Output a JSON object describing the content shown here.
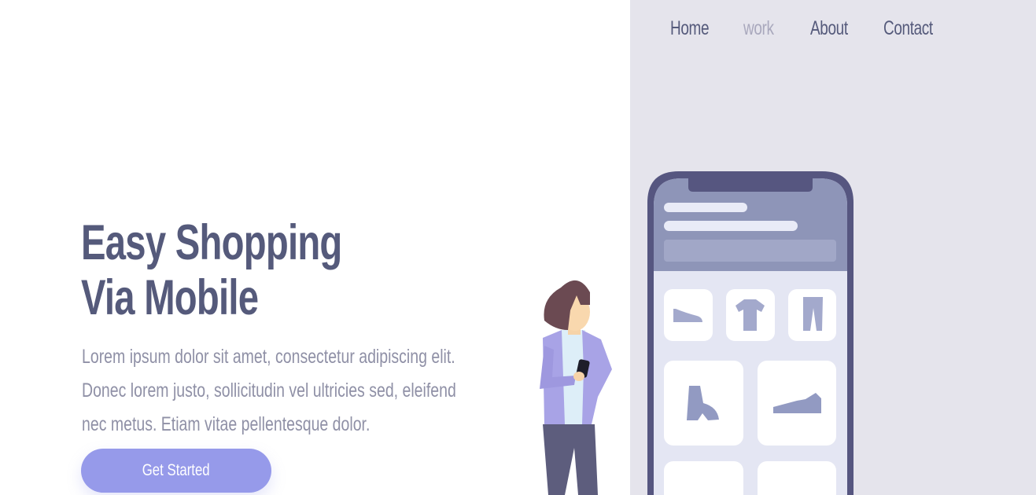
{
  "nav": {
    "items": [
      {
        "label": "Home",
        "active": false
      },
      {
        "label": "work",
        "active": true
      },
      {
        "label": "About",
        "active": false
      },
      {
        "label": "Contact",
        "active": false
      }
    ]
  },
  "hero": {
    "title_line1": "Easy Shopping",
    "title_line2": "Via Mobile",
    "description": "Lorem ipsum dolor sit amet, consectetur adipiscing elit. Donec lorem justo, sollicitudin vel ultricies sed, eleifend nec metus. Etiam vitae pellentesque dolor.",
    "cta_label": "Get Started"
  },
  "colors": {
    "heading": "#555a7b",
    "body_text": "#8f90a6",
    "nav_active": "#a9a8bd",
    "button": "#969aea",
    "panel": "#e5e4ec",
    "phone_frame": "#565680",
    "phone_header": "#8e95b8"
  },
  "illustration": {
    "product_icons": [
      "flat-shoe-icon",
      "tshirt-icon",
      "pants-icon",
      "boot-icon",
      "sneaker-icon"
    ]
  }
}
